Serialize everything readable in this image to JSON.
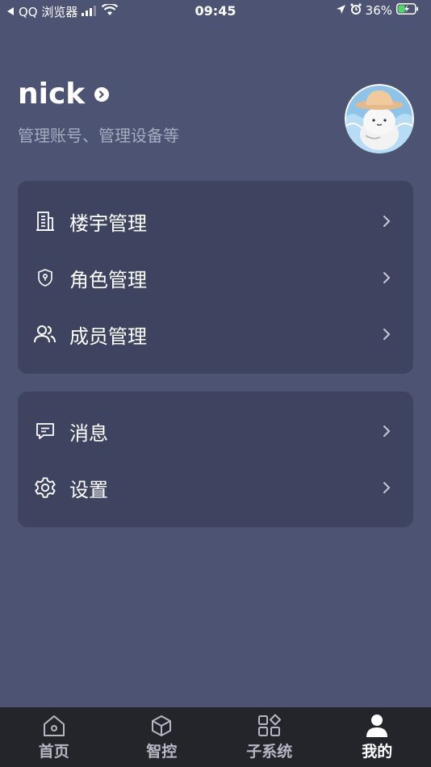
{
  "status_bar": {
    "back_app": "QQ 浏览器",
    "time": "09:45",
    "battery": "36%"
  },
  "profile": {
    "name": "nick",
    "subtitle": "管理账号、管理设备等"
  },
  "menu_group_1": [
    {
      "label": "楼宇管理",
      "icon": "building-icon"
    },
    {
      "label": "角色管理",
      "icon": "shield-icon"
    },
    {
      "label": "成员管理",
      "icon": "members-icon"
    }
  ],
  "menu_group_2": [
    {
      "label": "消息",
      "icon": "message-icon"
    },
    {
      "label": "设置",
      "icon": "gear-icon"
    }
  ],
  "tabbar": {
    "items": [
      {
        "label": "首页",
        "icon": "home-icon"
      },
      {
        "label": "智控",
        "icon": "cube-icon"
      },
      {
        "label": "子系统",
        "icon": "grid-icon"
      },
      {
        "label": "我的",
        "icon": "person-icon"
      }
    ],
    "active": "我的"
  },
  "colors": {
    "background": "#4d5373",
    "card": "#3e445f",
    "tabbar": "#23252b",
    "subtitle": "#a7abc0"
  }
}
